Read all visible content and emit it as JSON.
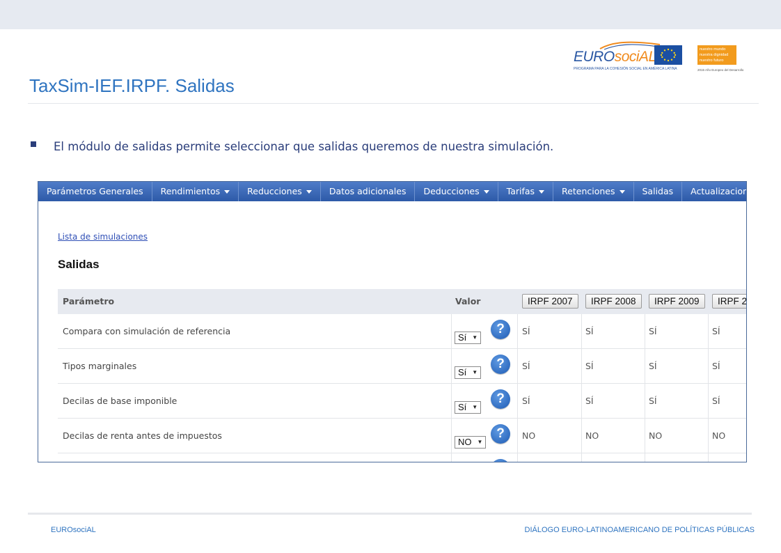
{
  "slide": {
    "title": "TaxSim-IEF.IRPF. Salidas",
    "bullet": "El módulo de salidas permite seleccionar que salidas queremos de nuestra simulación."
  },
  "logos": {
    "eurosocial_prefix": "EURO",
    "eurosocial_suffix": "sociAL",
    "eurosocial_sub": "PROGRAMA PARA LA COHESIÓN SOCIAL EN AMÉRICA LATINA",
    "badge_lines": [
      "nuestro mundo",
      "nuestra dignidad",
      "nuestro futuro"
    ],
    "badge_sub": "2015 Año Europeo del Desarrollo"
  },
  "app": {
    "menu": [
      {
        "label": "Parámetros Generales",
        "dropdown": false
      },
      {
        "label": "Rendimientos",
        "dropdown": true
      },
      {
        "label": "Reducciones",
        "dropdown": true
      },
      {
        "label": "Datos adicionales",
        "dropdown": false
      },
      {
        "label": "Deducciones",
        "dropdown": true
      },
      {
        "label": "Tarifas",
        "dropdown": true
      },
      {
        "label": "Retenciones",
        "dropdown": true
      },
      {
        "label": "Salidas",
        "dropdown": false
      },
      {
        "label": "Actualizaciones",
        "dropdown": true
      }
    ],
    "breadcrumb": "Lista de simulaciones",
    "section_title": "Salidas",
    "table": {
      "col_parametro": "Parámetro",
      "col_valor": "Valor",
      "years": [
        "IRPF 2007",
        "IRPF 2008",
        "IRPF 2009",
        "IRPF 2"
      ],
      "help_glyph": "?",
      "rows": [
        {
          "label": "Compara con simulación de referencia",
          "select": "Sí",
          "values": [
            "SÍ",
            "SÍ",
            "SÍ",
            "SÍ"
          ]
        },
        {
          "label": "Tipos marginales",
          "select": "Sí",
          "values": [
            "SÍ",
            "SÍ",
            "SÍ",
            "SÍ"
          ]
        },
        {
          "label": "Decilas de base imponible",
          "select": "Sí",
          "values": [
            "SÍ",
            "SÍ",
            "SÍ",
            "SÍ"
          ]
        },
        {
          "label": "Decilas de renta antes de impuestos",
          "select": "NO",
          "values": [
            "NO",
            "NO",
            "NO",
            "NO"
          ]
        }
      ]
    }
  },
  "footer": {
    "left": "EUROsociAL",
    "right": "DIÁLOGO EURO-LATINOAMERICANO DE POLÍTICAS PÚBLICAS"
  },
  "colors": {
    "title_blue": "#2f74c0",
    "menu_blue": "#2d5aa8",
    "text_navy": "#2a3d7a",
    "eu_blue": "#1b4fa2",
    "badge_orange": "#f29b1d"
  }
}
